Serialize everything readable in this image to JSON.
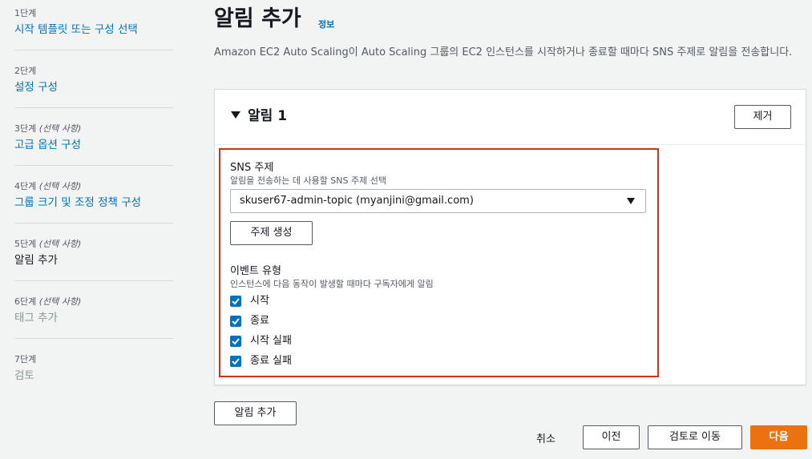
{
  "sidebar": {
    "steps": [
      {
        "num": "1단계",
        "optional": "",
        "name": "시작 템플릿 또는 구성 선택",
        "state": "link"
      },
      {
        "num": "2단계",
        "optional": "",
        "name": "설정 구성",
        "state": "link"
      },
      {
        "num": "3단계",
        "optional": "(선택 사항)",
        "name": "고급 옵션 구성",
        "state": "link"
      },
      {
        "num": "4단계",
        "optional": "(선택 사항)",
        "name": "그룹 크기 및 조정 정책 구성",
        "state": "link"
      },
      {
        "num": "5단계",
        "optional": "(선택 사항)",
        "name": "알림 추가",
        "state": "current"
      },
      {
        "num": "6단계",
        "optional": "(선택 사항)",
        "name": "태그 추가",
        "state": "disabled"
      },
      {
        "num": "7단계",
        "optional": "",
        "name": "검토",
        "state": "disabled"
      }
    ]
  },
  "page": {
    "title": "알림 추가",
    "info_link": "정보",
    "description": "Amazon EC2 Auto Scaling이 Auto Scaling 그룹의 EC2 인스턴스를 시작하거나 종료할 때마다 SNS 주제로 알림을 전송합니다."
  },
  "notification": {
    "title": "알림 1",
    "remove_button": "제거",
    "sns_label": "SNS 주제",
    "sns_desc": "알림을 전송하는 데 사용할 SNS 주제 선택",
    "sns_selected": "skuser67-admin-topic (myanjini@gmail.com)",
    "create_topic_button": "주제 생성",
    "event_label": "이벤트 유형",
    "event_desc": "인스턴스에 다음 동작이 발생할 때마다 구독자에게 알림",
    "events": [
      {
        "label": "시작",
        "checked": true
      },
      {
        "label": "종료",
        "checked": true
      },
      {
        "label": "시작 실패",
        "checked": true
      },
      {
        "label": "종료 실패",
        "checked": true
      }
    ]
  },
  "actions": {
    "add_notification": "알림 추가",
    "cancel": "취소",
    "previous": "이전",
    "go_to_review": "검토로 이동",
    "next": "다음"
  },
  "colors": {
    "link": "#0073bb",
    "primary": "#ec7211",
    "highlight": "#d13212"
  }
}
